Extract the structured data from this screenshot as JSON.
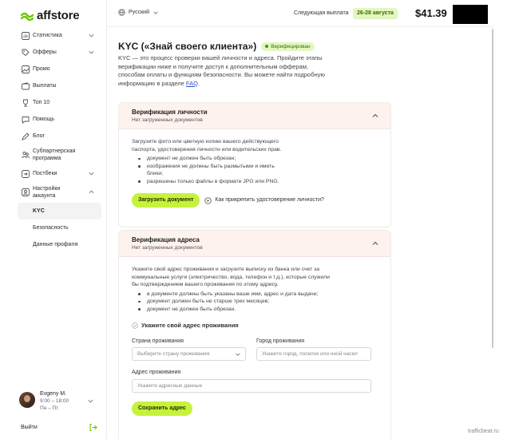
{
  "brand": {
    "name": "affstore",
    "accent": "#c7f23c",
    "logo_color": "#6cc900"
  },
  "topbar": {
    "language": "Русский",
    "next_payout_label": "Следующая выплата",
    "next_payout_date": "26-28 августа",
    "balance": "$41.39"
  },
  "sidebar": {
    "items": [
      {
        "label": "Статистика",
        "icon": "stats-icon",
        "expandable": true
      },
      {
        "label": "Офферы",
        "icon": "tag-icon",
        "expandable": true
      },
      {
        "label": "Промо",
        "icon": "image-icon",
        "expandable": false
      },
      {
        "label": "Выплаты",
        "icon": "wallet-icon",
        "expandable": false
      },
      {
        "label": "Топ 10",
        "icon": "trophy-icon",
        "expandable": false
      },
      {
        "label": "Помощь",
        "icon": "chat-icon",
        "expandable": false
      },
      {
        "label": "Блог",
        "icon": "blog-icon",
        "expandable": false
      },
      {
        "label": "Субпартнерская программа",
        "icon": "partners-icon",
        "expandable": false
      },
      {
        "label": "Постбеки",
        "icon": "postback-icon",
        "expandable": true
      },
      {
        "label": "Настройки аккаунта",
        "icon": "user-settings-icon",
        "expandable": true
      }
    ],
    "subitems": [
      {
        "label": "KYC",
        "active": true
      },
      {
        "label": "Безопасность",
        "active": false
      },
      {
        "label": "Данные профиля",
        "active": false
      }
    ],
    "manager": {
      "name": "Evgeny M.",
      "hours": "9:00 – 18:00",
      "days": "Пн – Пт"
    },
    "logout": "Выйти"
  },
  "page": {
    "title": "KYC («Знай своего клиента»)",
    "status_badge": "Верифицирован",
    "intro": "KYC — это процесс проверки вашей личности и адреса. Пройдите этапы верификации ниже и получите доступ к дополнительным офферам, способам оплаты и функциям безопасности. Вы можете найти подробную информацию в разделе ",
    "intro_link": "FAQ",
    "intro_end": "."
  },
  "identity": {
    "title": "Верификация личности",
    "status": "Нет загруженных документов",
    "description": "Загрузите фото или цветную копию вашего действующего паспорта, удостоверения личности или водительских прав.",
    "rules": [
      "документ не должен быть обрезан;",
      "изображения не должны быть размытыми и иметь блики;",
      "разрешены только файлы в формате JPG или PNG."
    ],
    "upload_button": "Загрузить документ",
    "help_link": "Как прикрепить удостоверение личности?"
  },
  "address": {
    "title": "Верификация адреса",
    "status": "Нет загруженных документов",
    "description": "Укажите свой адрес проживания и загрузите выписку из банка или счет за коммунальные услуги (электричество, вода, телефон и т.д.), которые служили бы подтверждением вашего проживания по этому адресу.",
    "rules": [
      "в документе должны быть указаны ваше имя, адрес и дата выдачи;",
      "документ должен быть не старше трех месяцев;",
      "документ не должен быть обрезан."
    ],
    "step_label": "Укажите свой адрес проживания",
    "country_label": "Страна проживания",
    "country_placeholder": "Выберите страну проживания",
    "city_label": "Город проживания",
    "city_placeholder": "Укажите город, поселок или иной насел",
    "address_label": "Адрес проживания",
    "address_placeholder": "Укажите адресные данные",
    "save_button": "Сохранить адрес"
  },
  "watermark": "trafficbeat.ru"
}
